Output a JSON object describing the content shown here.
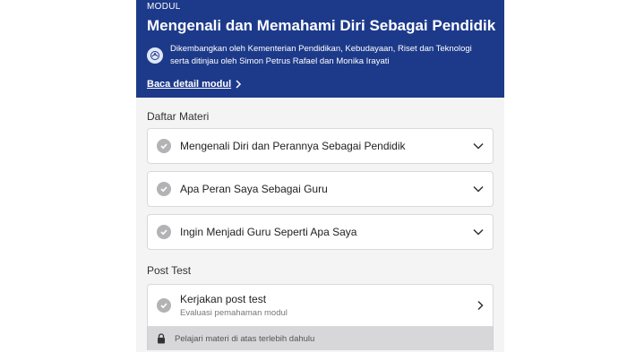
{
  "header": {
    "eyebrow": "MODUL",
    "title": "Mengenali dan Memahami Diri Sebagai Pendidik",
    "developer_line1": "Dikembangkan oleh Kementerian Pendidikan, Kebudayaan, Riset dan Teknologi",
    "developer_line2": "serta ditinjau oleh Simon Petrus Rafael dan Monika Irayati",
    "detail_link": "Baca detail modul",
    "logo_icon": "ministry-logo-icon"
  },
  "materials": {
    "section_title": "Daftar Materi",
    "items": [
      {
        "label": "Mengenali Diri dan Perannya Sebagai Pendidik",
        "icon": "check-circle-icon",
        "action_icon": "chevron-down-icon"
      },
      {
        "label": "Apa Peran Saya Sebagai Guru",
        "icon": "check-circle-icon",
        "action_icon": "chevron-down-icon"
      },
      {
        "label": "Ingin Menjadi Guru Seperti Apa Saya",
        "icon": "check-circle-icon",
        "action_icon": "chevron-down-icon"
      }
    ]
  },
  "post_test": {
    "section_title": "Post Test",
    "title": "Kerjakan post test",
    "subtitle": "Evaluasi pemahaman modul",
    "locked_text": "Pelajari materi di atas terlebih dahulu"
  },
  "colors": {
    "header_bg": "#1d3a8a",
    "panel_bg": "#f4f4f5",
    "check_gray": "#b3b3b6",
    "locked_bg": "#d7d7da"
  }
}
